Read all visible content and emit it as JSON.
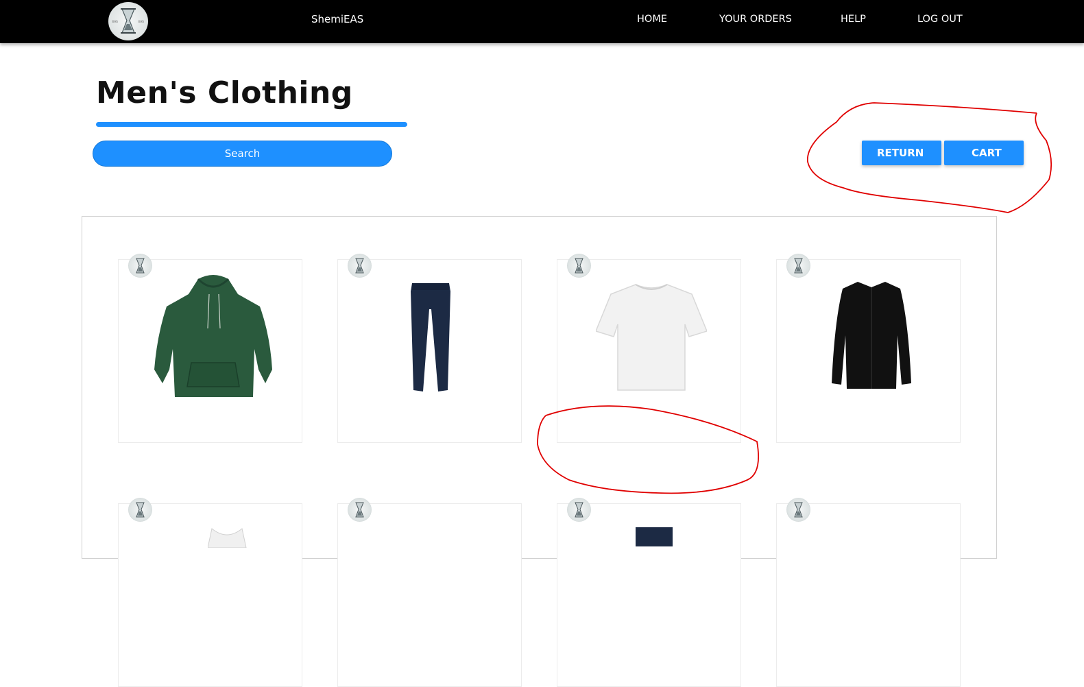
{
  "navbar": {
    "brand": "ShemiEAS",
    "links": [
      "HOME",
      "YOUR ORDERS",
      "HELP",
      "LOG OUT"
    ],
    "logo_icon": "hourglass-logo-icon"
  },
  "page": {
    "title": "Men's Clothing",
    "search_label": "Search",
    "return_label": "RETURN",
    "cart_label": "CART"
  },
  "products": [
    {
      "icon": "green-hoodie-icon",
      "color": "#2a5a3d"
    },
    {
      "icon": "navy-pants-icon",
      "color": "#1c2a44"
    },
    {
      "icon": "white-tshirt-icon",
      "color": "#f2f2f2"
    },
    {
      "icon": "black-shirt-icon",
      "color": "#111111"
    },
    {
      "icon": "white-tank-icon",
      "color": "#f0f0f0"
    },
    {
      "icon": "product-image-icon",
      "color": "#ffffff"
    },
    {
      "icon": "navy-jeans-icon",
      "color": "#1c2a44"
    },
    {
      "icon": "product-image-icon",
      "color": "#ffffff"
    }
  ],
  "colors": {
    "accent": "#1e90ff",
    "navbar": "#000000",
    "annotation": "#e00000"
  }
}
